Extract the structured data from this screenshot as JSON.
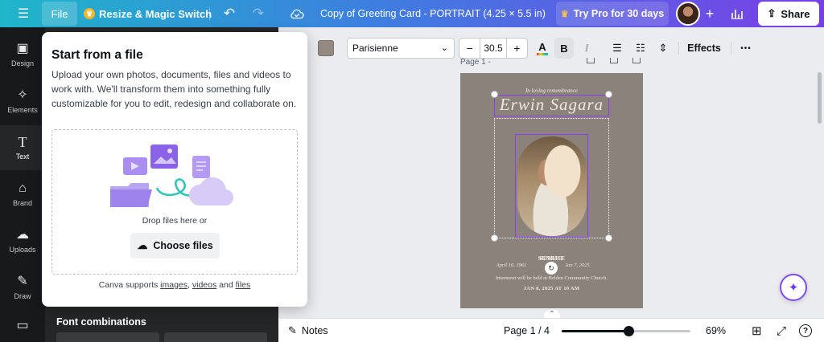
{
  "topbar": {
    "file_label": "File",
    "resize_label": "Resize & Magic Switch",
    "title": "Copy of  Greeting Card - PORTRAIT (4.25 × 5.5 in)",
    "pro_label": "Try Pro for 30 days",
    "share_label": "Share"
  },
  "rail": {
    "items": [
      {
        "label": "Design",
        "icon": "design-icon"
      },
      {
        "label": "Elements",
        "icon": "elements-icon"
      },
      {
        "label": "Text",
        "icon": "text-icon"
      },
      {
        "label": "Brand",
        "icon": "brand-icon"
      },
      {
        "label": "Uploads",
        "icon": "cloud-upload-icon"
      },
      {
        "label": "Draw",
        "icon": "pen-icon"
      },
      {
        "label": "",
        "icon": "folder-icon"
      }
    ]
  },
  "panel": {
    "font_combinations": "Font combinations"
  },
  "popup": {
    "title": "Start from a file",
    "description": "Upload your own photos, documents, files and videos to work with. We'll transform them into something fully customizable for you to edit, redesign and collaborate on.",
    "drop_text": "Drop files here or",
    "choose_label": "Choose files",
    "foot_prefix": "Canva supports ",
    "foot_images": "images",
    "foot_sep": ", ",
    "foot_videos": "videos",
    "foot_and": " and ",
    "foot_files": "files"
  },
  "toolbar": {
    "text_color": "#948a82",
    "font_name": "Parisienne",
    "font_size": "30.5",
    "minus": "−",
    "plus": "+",
    "bold": "B",
    "italic": "I",
    "effects": "Effects",
    "more": "•••"
  },
  "canvas": {
    "page_label": "Page 1 -",
    "card": {
      "remembrance": "In loving remembrance",
      "name": "Erwin Sagara",
      "sunrise_label": "SUNRISE",
      "sunset_label": "SUNSET",
      "sunrise_date": "April 10, 1961",
      "sunset_date": "Jan 7, 2025",
      "interment": "Interment will be held at Belden Community Church.",
      "funeral_date": "JAN 8, 2025 AT 10 AM"
    }
  },
  "bottombar": {
    "notes_label": "Notes",
    "page_indicator": "Page 1 / 4",
    "zoom_label": "69%",
    "zoom_fraction": 0.52
  }
}
